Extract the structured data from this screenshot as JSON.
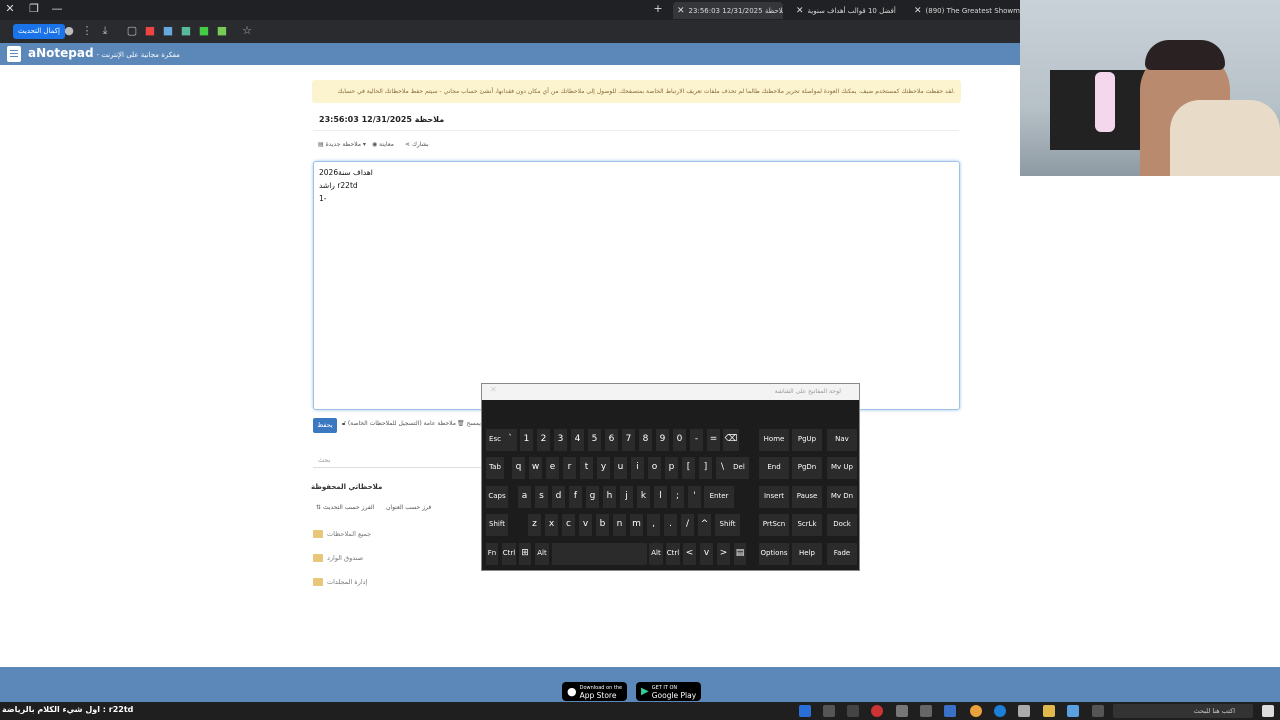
{
  "browser": {
    "tabs": [
      {
        "label": "(890) The Greatest Showm"
      },
      {
        "label": "أفضل 10 قوالب أهداف سنوية"
      },
      {
        "label": "ملاحظة 12/31/2025 23:56:03"
      }
    ],
    "update_label": "إكمال التحديث"
  },
  "site": {
    "logo": "aNotepad",
    "tagline": "- مفكرة مجانية على الإنترنت",
    "warning": "لقد حفظت ملاحظتك كمستخدم ضيف. يمكنك العودة لمواصلة تحرير ملاحظتك طالما لم تحذف ملفات تعريف الارتباط الخاصة بمتصفحك. للوصول إلى ملاحظاتك من أي مكان دون فقدانها، أنشئ حساب مجاني - سيتم حفظ ملاحظاتك الحالية في حسابك."
  },
  "note": {
    "title": "ملاحظة 12/31/2025 23:56:03",
    "new_note": "ملاحظة جديدة",
    "preview": "معاينة",
    "share": "بشارك",
    "lines": [
      "اهداف سنة2026",
      "راشد r22td",
      "1-"
    ],
    "save": "يحفظ",
    "public_note": "ملاحظة عامة (التسجيل للملاحظات الخاصة)",
    "clear": "يمسح"
  },
  "sidebar": {
    "search_placeholder": "بحث",
    "saved_title": "ملاحظاتي المحفوظة",
    "sort_date": "الفرز حسب التحديث",
    "sort_title": "فرز حسب العنوان",
    "folders": [
      "جميع الملاحظات",
      "صندوق الوارد",
      "إدارة المجلدات"
    ]
  },
  "footer": {
    "app_store": "App Store",
    "app_store_small": "Download on the",
    "google_play": "Google Play",
    "google_play_small": "GET IT ON"
  },
  "taskbar": {
    "left_text": "اول شيء الكلام بالرياضة : r22td",
    "search": "اكتب هنا للبحث"
  },
  "keyboard": {
    "title": "لوحة المفاتيح على الشاشة"
  }
}
